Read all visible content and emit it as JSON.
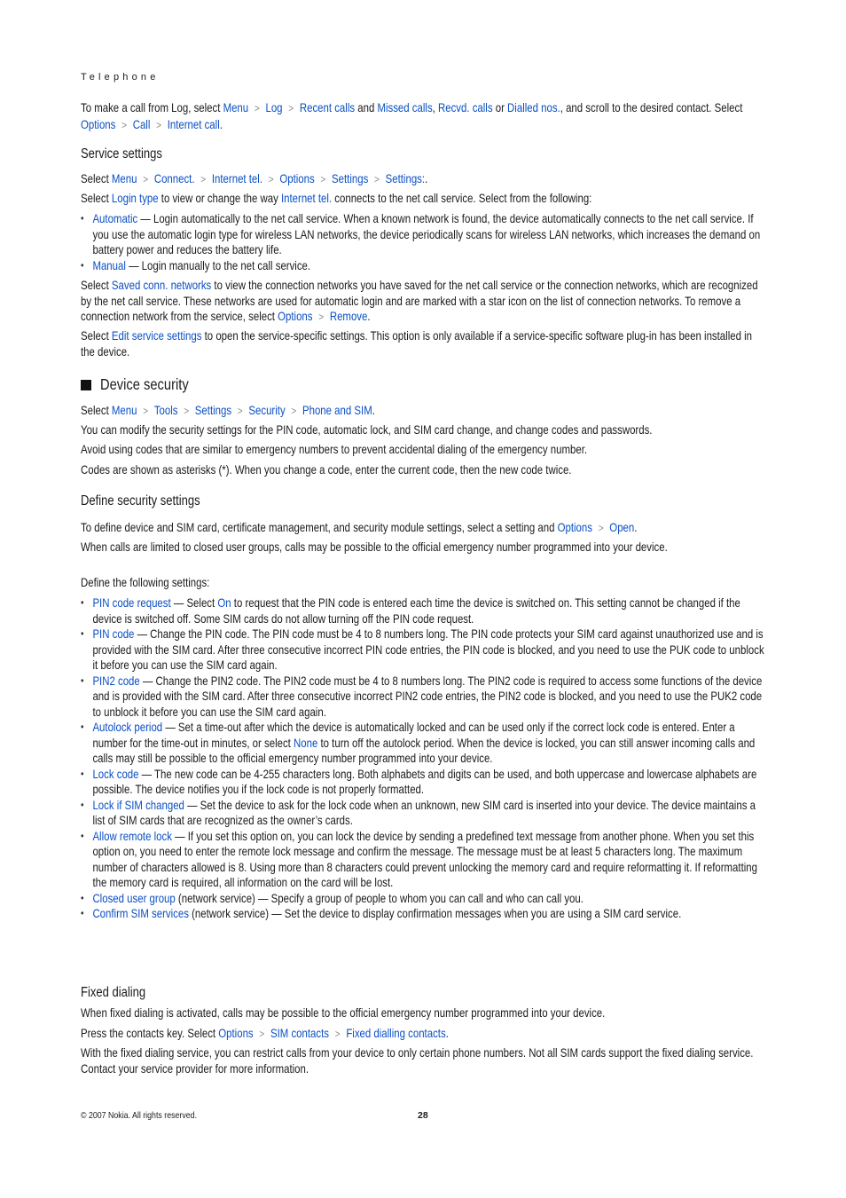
{
  "header": {
    "running_title": "Telephone"
  },
  "intro": {
    "t1": "To make a call from Log, select ",
    "path1": [
      "Menu",
      "Log",
      "Recent calls"
    ],
    "t2": " and ",
    "l_missed": "Missed calls",
    "t3": ", ",
    "l_recvd": "Recvd. calls",
    "t4": " or ",
    "l_dialled": "Dialled nos.",
    "t5": ", and scroll to the desired contact. Select ",
    "path2": [
      "Options",
      "Call",
      "Internet call"
    ],
    "t6": "."
  },
  "service_settings": {
    "heading": "Service settings",
    "select": "Select ",
    "path": [
      "Menu",
      "Connect.",
      "Internet tel.",
      "Options",
      "Settings",
      "Settings:"
    ],
    "p1a": "Select ",
    "p1_link1": "Login type",
    "p1b": " to view or change the way ",
    "p1_link2": "Internet tel.",
    "p1c": " connects to the net call service. Select from the following:",
    "items": [
      {
        "term": "Automatic",
        "text": " — Login automatically to the net call service. When a known network is found, the device automatically connects to the net call service. If you use the automatic login type for wireless LAN networks, the device periodically scans for wireless LAN networks, which increases the demand on battery power and reduces the battery life."
      },
      {
        "term": "Manual",
        "text": " —  Login manually to the net call service."
      }
    ],
    "p2a": "Select ",
    "p2_link": "Saved conn. networks",
    "p2b": " to view the connection networks you have saved for the net call service or the connection networks, which are recognized by the net call service. These networks are used for automatic login and are marked with a star icon on the list of connection networks. To remove a connection network from the service, select ",
    "p2_path": [
      "Options",
      "Remove"
    ],
    "p3a": "Select ",
    "p3_link": "Edit service settings",
    "p3b": " to open the service-specific settings. This option is only available if a service-specific software plug-in has been installed in the device."
  },
  "device_security": {
    "heading": "Device security",
    "select": "Select ",
    "path": [
      "Menu",
      "Tools",
      "Settings",
      "Security",
      "Phone and SIM"
    ],
    "p1": "You can modify the security settings for the PIN code, automatic lock, and SIM card change, and change codes and passwords.",
    "p2": "Avoid using codes that are similar to emergency numbers to prevent accidental dialing of the emergency number.",
    "p3": "Codes are shown as asterisks (*). When you change a code, enter the current code, then the new code twice."
  },
  "define_security": {
    "heading": "Define security settings",
    "p1": "To define device and SIM card, certificate management, and security module settings, select a setting and ",
    "p1_path": [
      "Options",
      "Open"
    ],
    "p2": "When calls are limited to closed user groups, calls may be possible to the official emergency number programmed into your device.",
    "p3": "Define the following settings:",
    "items": [
      {
        "term": "PIN code request",
        "a": " — Select ",
        "link": "On",
        "b": " to request that the PIN code is entered each time the device is switched on. This setting cannot be changed if the device is switched off. Some SIM cards do not allow turning off the PIN code request."
      },
      {
        "term": "PIN code",
        "a": " — Change the PIN code. The PIN code must be 4 to 8 numbers long. The PIN code protects your SIM card against unauthorized use and is provided with the SIM card. After three consecutive incorrect PIN code entries, the PIN code is blocked, and you need to use the PUK code to unblock it before you can use the SIM card again."
      },
      {
        "term": "PIN2 code",
        "a": " — Change the PIN2 code. The PIN2 code must be 4 to 8 numbers long. The PIN2 code is required to access some functions of the device and is provided with the SIM card. After three consecutive incorrect PIN2 code entries, the PIN2 code is blocked, and you need to use the PUK2 code to unblock it before you can use the SIM card again."
      },
      {
        "term": "Autolock period",
        "a": "  — Set a time-out after which the device is automatically locked and can be used only if the correct lock code is entered. Enter a number for the time-out in minutes, or select ",
        "link": "None",
        "b": " to turn off the autolock period. When the device is locked, you can still answer incoming calls and calls may still be possible to the official emergency number programmed into your device."
      },
      {
        "term": "Lock code",
        "a": " — The new code can be 4-255 characters long. Both alphabets and digits can be used, and both uppercase and lowercase alphabets are possible. The device notifies you if the lock code is not properly formatted."
      },
      {
        "term": "Lock if SIM changed",
        "a": " — Set the device to ask for the lock code when an unknown, new SIM card is inserted into your device. The device maintains a list of SIM cards that are recognized as the owner’s cards."
      },
      {
        "term": "Allow remote lock",
        "a": " — If you set this option on, you can lock the device by sending a predefined text message from another phone. When you set this option on, you need to enter the remote lock message and confirm the message. The message must be at least 5 characters long. The maximum number of characters allowed is 8. Using more than 8 characters could prevent unlocking the memory card and require reformatting it. If reformatting the memory card is required, all information on the card will be lost."
      },
      {
        "term": "Closed user group",
        "a": " (network service) — Specify a group of people to whom you can call and who can call you."
      },
      {
        "term": "Confirm SIM services",
        "a": " (network service) — Set the device to display confirmation messages when you are using a SIM card service."
      }
    ]
  },
  "fixed_dialing": {
    "heading": "Fixed dialing",
    "p1": "When fixed dialing is activated, calls may be possible to the official emergency number programmed into your device.",
    "p2": "Press the contacts key. Select ",
    "p2_path": [
      "Options",
      "SIM contacts",
      "Fixed dialling contacts"
    ],
    "p3": "With the fixed dialing service, you can restrict calls from your device to only certain phone numbers. Not all SIM cards support the fixed dialing service. Contact your service provider for more information."
  },
  "footer": {
    "copyright": "© 2007 Nokia. All rights reserved.",
    "page_number": "28"
  },
  "colors": {
    "link": "#0a4fc4",
    "text": "#1a1a1a"
  }
}
